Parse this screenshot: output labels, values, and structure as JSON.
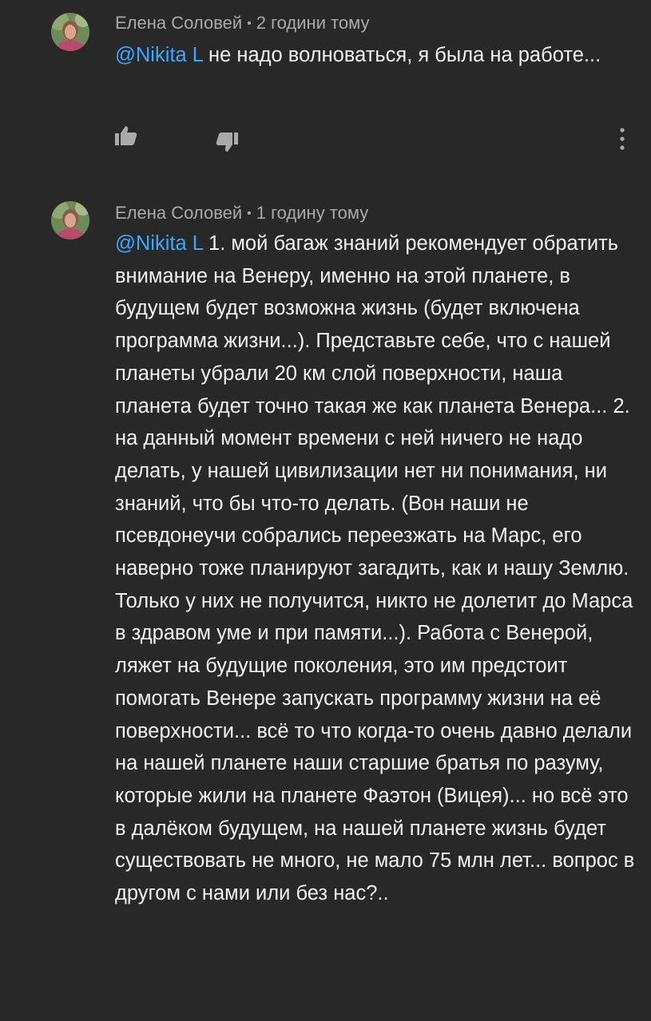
{
  "comments": [
    {
      "author": "Елена Соловей",
      "separator": "•",
      "time": "2 години тому",
      "mention": "@Nikita L",
      "text": " не надо волноваться, я была на работе..."
    },
    {
      "author": "Елена Соловей",
      "separator": "•",
      "time": "1 годину тому",
      "mention": "@Nikita L",
      "text": " 1. мой багаж знаний рекомендует обратить внимание на Венеру, именно на этой планете, в будущем будет возможна жизнь (будет включена программа жизни...). Представьте себе, что с нашей планеты убрали 20 км слой поверхности, наша планета будет точно такая же как планета Венера... 2. на данный момент времени с ней ничего не надо делать, у нашей цивилизации нет ни понимания, ни знаний, что бы что-то делать. (Вон наши не псевдонеучи собрались переезжать на Марс, его наверно тоже планируют загадить, как и нашу Землю. Только у них не получится, никто не долетит до Марса в здравом уме и при памяти...). Работа с Венерой, ляжет на будущие поколения, это им предстоит помогать Венере запускать программу жизни на её поверхности... всё то что когда-то очень давно делали на нашей планете наши старшие братья по разуму, которые жили на планете Фаэтон (Вицея)... но всё это в далёком будущем, на нашей планете жизнь будет существовать не много, не мало 75 млн лет... вопрос в другом с нами или без нас?.."
    }
  ],
  "icons": {
    "like": "thumb-up-icon",
    "dislike": "thumb-down-icon",
    "more": "more-vert-icon"
  },
  "colors": {
    "background": "#282828",
    "text": "#f1f1f1",
    "meta": "#aaaaaa",
    "mention": "#3ea6ff",
    "icon": "#aaaaaa"
  }
}
